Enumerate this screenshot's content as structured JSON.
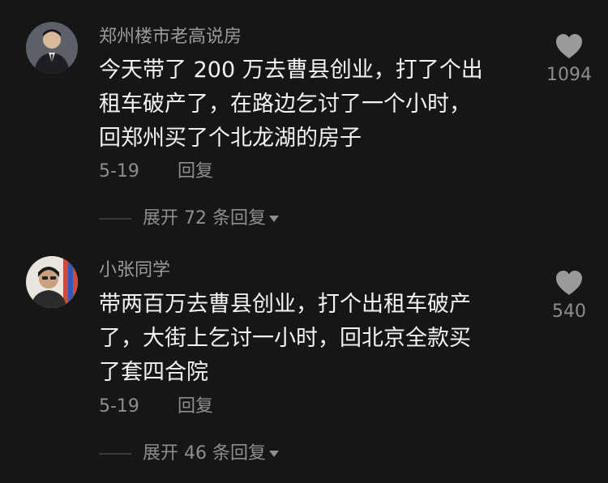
{
  "comments": [
    {
      "username": "郑州楼市老高说房",
      "lines": [
        "今天带了 200 万去曹县创业，打了个出",
        "租车破产了，在路边乞讨了一个小时，",
        "回郑州买了个北龙湖的房子"
      ],
      "date": "5-19",
      "reply_label": "回复",
      "expand_label": "展开 72 条回复",
      "like_count": "1094"
    },
    {
      "username": "小张同学",
      "lines": [
        "带两百万去曹县创业，打个出租车破产",
        "了，大街上乞讨一小时，回北京全款买",
        "了套四合院"
      ],
      "date": "5-19",
      "reply_label": "回复",
      "expand_label": "展开 46 条回复",
      "like_count": "540"
    }
  ],
  "colors": {
    "background": "#161616",
    "text": "#f2f2f2",
    "muted": "#8e8e8e",
    "heart": "#9a9a9a"
  },
  "icons": {
    "like": "heart-icon",
    "expand": "caret-down-icon"
  }
}
